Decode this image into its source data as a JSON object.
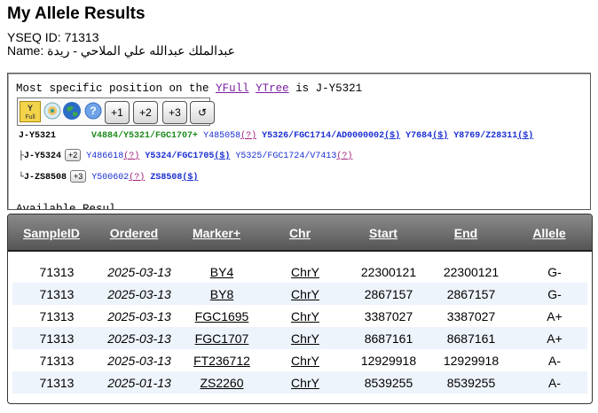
{
  "page": {
    "title": "My Allele Results",
    "yseq_label": "YSEQ ID: 71313",
    "name_label": "Name:",
    "name_value": "عبدالملك عبدالله علي الملاحي - ريدة"
  },
  "panel": {
    "intro_text": "Most specific position on the",
    "yfull_link": "YFull",
    "ytree_link": "YTree",
    "is_text": "is J-Y5321",
    "toolbar": {
      "yfull_icon_label": "Full",
      "buttons": [
        "+1",
        "+2",
        "+3",
        "↺"
      ]
    },
    "rows": [
      {
        "label": "J-Y5321",
        "plus": "",
        "items": [
          {
            "text": "V4884/Y5321/FGC1707+",
            "style": "g"
          },
          {
            "text": "Y485058",
            "style": "b",
            "suffix": "(?)"
          },
          {
            "text": "Y5326/FGC1714/AD0000002",
            "style": "bb",
            "suffix": "($)"
          },
          {
            "text": "Y7684",
            "style": "bb",
            "suffix": "($)"
          },
          {
            "text": "Y8769/Z28311",
            "style": "bb",
            "suffix": "($)"
          }
        ]
      },
      {
        "label": "├J-Y5324",
        "plus": "+2",
        "items": [
          {
            "text": "Y486618",
            "style": "b",
            "suffix": "(?)"
          },
          {
            "text": "Y5324/FGC1705",
            "style": "bb",
            "suffix": "($)"
          },
          {
            "text": "Y5325/FGC1724/V7413",
            "style": "b",
            "suffix": "(?)"
          }
        ]
      },
      {
        "label": "└J-ZS8508",
        "plus": "+3",
        "items": [
          {
            "text": "Y500602",
            "style": "b",
            "suffix": "(?)"
          },
          {
            "text": "ZS8508",
            "style": "bb",
            "suffix": "($)"
          }
        ]
      }
    ],
    "cut_text": "Available Resul"
  },
  "table": {
    "headers": [
      "SampleID",
      "Ordered",
      "Marker+",
      "Chr",
      "Start",
      "End",
      "Allele"
    ],
    "rows": [
      [
        "71313",
        "2025-03-13",
        "BY4",
        "ChrY",
        "22300121",
        "22300121",
        "G-"
      ],
      [
        "71313",
        "2025-03-13",
        "BY8",
        "ChrY",
        "2867157",
        "2867157",
        "G-"
      ],
      [
        "71313",
        "2025-03-13",
        "FGC1695",
        "ChrY",
        "3387027",
        "3387027",
        "A+"
      ],
      [
        "71313",
        "2025-03-13",
        "FGC1707",
        "ChrY",
        "8687161",
        "8687161",
        "A+"
      ],
      [
        "71313",
        "2025-03-13",
        "FT236712",
        "ChrY",
        "12929918",
        "12929918",
        "A-"
      ],
      [
        "71313",
        "2025-01-13",
        "ZS2260",
        "ChrY",
        "8539255",
        "8539255",
        "A-"
      ]
    ]
  }
}
